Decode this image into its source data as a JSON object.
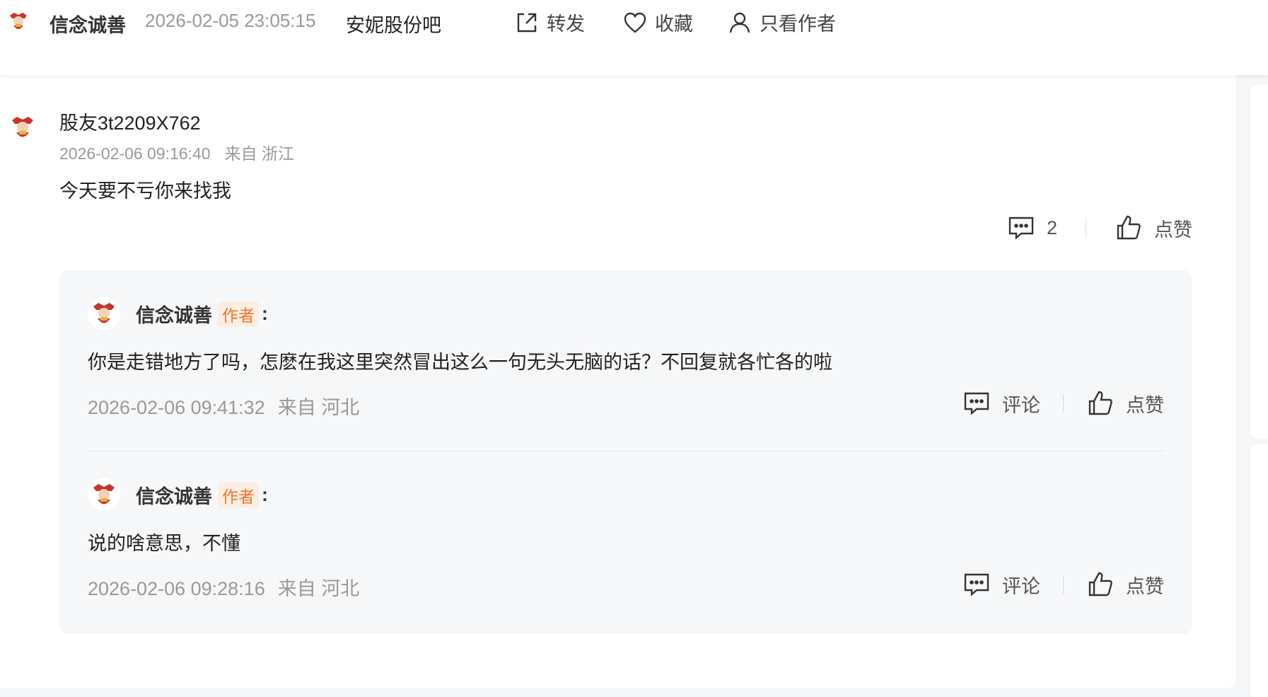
{
  "header": {
    "author_name": "信念诚善",
    "post_time": "2026-02-05 23:05:15",
    "bar_name": "安妮股份吧",
    "share_label": "转发",
    "favorite_label": "收藏",
    "only_author_label": "只看作者"
  },
  "comment": {
    "user": "股友3t2209X762",
    "time": "2026-02-06 09:16:40",
    "location": "来自 浙江",
    "text": "今天要不亏你来找我",
    "reply_count": "2",
    "like_label": "点赞"
  },
  "replies": [
    {
      "name": "信念诚善",
      "tag": "作者",
      "colon": ":",
      "text": "你是走错地方了吗，怎麽在我这里突然冒出这么一句无头无脑的话？不回复就各忙各的啦",
      "time": "2026-02-06 09:41:32",
      "location": "来自 河北",
      "comment_label": "评论",
      "like_label": "点赞"
    },
    {
      "name": "信念诚善",
      "tag": "作者",
      "colon": ":",
      "text": "说的啥意思，不懂",
      "time": "2026-02-06 09:28:16",
      "location": "来自 河北",
      "comment_label": "评论",
      "like_label": "点赞"
    }
  ],
  "icons": {
    "share": "share-icon",
    "favorite": "heart-icon",
    "only_author": "user-icon",
    "comment": "comment-icon",
    "like": "thumbs-up-icon"
  },
  "colors": {
    "author_tag_bg": "#fdeee4",
    "author_tag_text": "#f5742a",
    "meta_gray": "#999999"
  }
}
